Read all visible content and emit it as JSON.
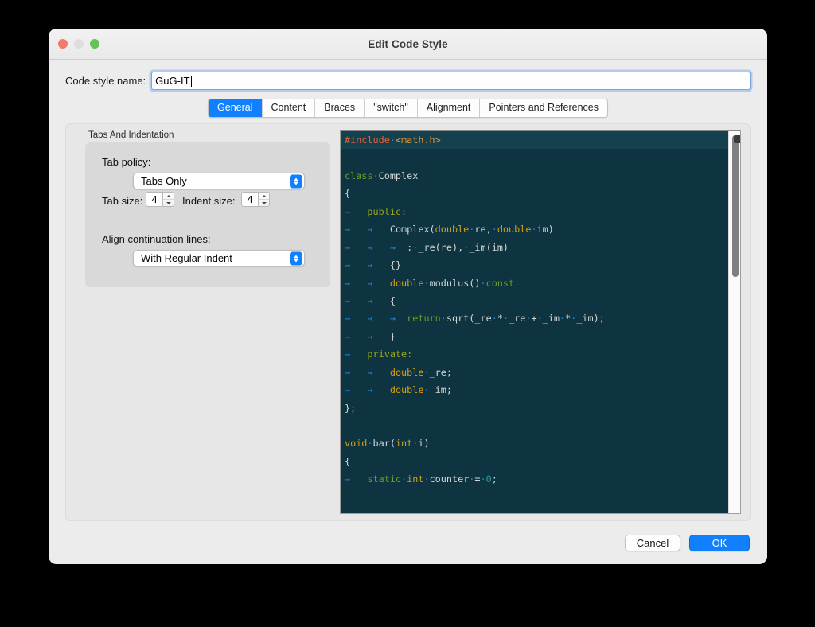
{
  "window": {
    "title": "Edit Code Style",
    "traffic_lights": [
      "close",
      "minimize",
      "zoom"
    ]
  },
  "name_row": {
    "label": "Code style name:",
    "value": "GuG-IT",
    "placeholder": ""
  },
  "tabs": [
    {
      "label": "General",
      "active": true
    },
    {
      "label": "Content",
      "active": false
    },
    {
      "label": "Braces",
      "active": false
    },
    {
      "label": "\"switch\"",
      "active": false
    },
    {
      "label": "Alignment",
      "active": false
    },
    {
      "label": "Pointers and References",
      "active": false
    }
  ],
  "settings": {
    "group_title": "Tabs And Indentation",
    "tab_policy_label": "Tab policy:",
    "tab_policy_value": "Tabs Only",
    "tab_size_label": "Tab size:",
    "tab_size_value": "4",
    "indent_size_label": "Indent size:",
    "indent_size_value": "4",
    "align_label": "Align continuation lines:",
    "align_value": "With Regular Indent"
  },
  "preview": {
    "background": "#0d3440",
    "caret_line_background": "#14414d",
    "colors": {
      "preprocessor": "#e8603c",
      "string": "#df9a41",
      "keyword": "#6d9d28",
      "label": "#9aa818",
      "type": "#d2a017",
      "number": "#2e9e9e",
      "whitespace": "#1f87d6",
      "text": "#d4d8d6"
    },
    "lines": [
      {
        "caret": true,
        "tokens": [
          {
            "t": "#include",
            "c": "pre"
          },
          {
            "t": "·",
            "c": "dot"
          },
          {
            "t": "<math.h>",
            "c": "str"
          }
        ]
      },
      {
        "caret": false,
        "tokens": []
      },
      {
        "caret": false,
        "tokens": [
          {
            "t": "class",
            "c": "kw"
          },
          {
            "t": "·",
            "c": "dot"
          },
          {
            "t": "Complex",
            "c": "txt"
          }
        ]
      },
      {
        "caret": false,
        "tokens": [
          {
            "t": "{",
            "c": "txt"
          }
        ]
      },
      {
        "caret": false,
        "tokens": [
          {
            "t": "→   ",
            "c": "tab"
          },
          {
            "t": "public:",
            "c": "label"
          }
        ]
      },
      {
        "caret": false,
        "tokens": [
          {
            "t": "→   ",
            "c": "tab"
          },
          {
            "t": "→   ",
            "c": "tab"
          },
          {
            "t": "Complex(",
            "c": "txt"
          },
          {
            "t": "double",
            "c": "type"
          },
          {
            "t": "·",
            "c": "dot"
          },
          {
            "t": "re,",
            "c": "txt"
          },
          {
            "t": "·",
            "c": "dot"
          },
          {
            "t": "double",
            "c": "type"
          },
          {
            "t": "·",
            "c": "dot"
          },
          {
            "t": "im)",
            "c": "txt"
          }
        ]
      },
      {
        "caret": false,
        "tokens": [
          {
            "t": "→   ",
            "c": "tab"
          },
          {
            "t": "→   ",
            "c": "tab"
          },
          {
            "t": "→  ",
            "c": "tab"
          },
          {
            "t": ":",
            "c": "txt"
          },
          {
            "t": "·",
            "c": "dot"
          },
          {
            "t": "_re(re),",
            "c": "txt"
          },
          {
            "t": "·",
            "c": "dot"
          },
          {
            "t": "_im(im)",
            "c": "txt"
          }
        ]
      },
      {
        "caret": false,
        "tokens": [
          {
            "t": "→   ",
            "c": "tab"
          },
          {
            "t": "→   ",
            "c": "tab"
          },
          {
            "t": "{}",
            "c": "txt"
          }
        ]
      },
      {
        "caret": false,
        "tokens": [
          {
            "t": "→   ",
            "c": "tab"
          },
          {
            "t": "→   ",
            "c": "tab"
          },
          {
            "t": "double",
            "c": "type"
          },
          {
            "t": "·",
            "c": "dot"
          },
          {
            "t": "modulus()",
            "c": "txt"
          },
          {
            "t": "·",
            "c": "dot"
          },
          {
            "t": "const",
            "c": "kw"
          }
        ]
      },
      {
        "caret": false,
        "tokens": [
          {
            "t": "→   ",
            "c": "tab"
          },
          {
            "t": "→   ",
            "c": "tab"
          },
          {
            "t": "{",
            "c": "txt"
          }
        ]
      },
      {
        "caret": false,
        "tokens": [
          {
            "t": "→   ",
            "c": "tab"
          },
          {
            "t": "→   ",
            "c": "tab"
          },
          {
            "t": "→  ",
            "c": "tab"
          },
          {
            "t": "return",
            "c": "kw"
          },
          {
            "t": "·",
            "c": "dot"
          },
          {
            "t": "sqrt(_re",
            "c": "txt"
          },
          {
            "t": "·",
            "c": "dot"
          },
          {
            "t": "*",
            "c": "txt"
          },
          {
            "t": "·",
            "c": "dot"
          },
          {
            "t": "_re",
            "c": "txt"
          },
          {
            "t": "·",
            "c": "dot"
          },
          {
            "t": "+",
            "c": "txt"
          },
          {
            "t": "·",
            "c": "dot"
          },
          {
            "t": "_im",
            "c": "txt"
          },
          {
            "t": "·",
            "c": "dot"
          },
          {
            "t": "*",
            "c": "txt"
          },
          {
            "t": "·",
            "c": "dot"
          },
          {
            "t": "_im);",
            "c": "txt"
          }
        ]
      },
      {
        "caret": false,
        "tokens": [
          {
            "t": "→   ",
            "c": "tab"
          },
          {
            "t": "→   ",
            "c": "tab"
          },
          {
            "t": "}",
            "c": "txt"
          }
        ]
      },
      {
        "caret": false,
        "tokens": [
          {
            "t": "→   ",
            "c": "tab"
          },
          {
            "t": "private:",
            "c": "label"
          }
        ]
      },
      {
        "caret": false,
        "tokens": [
          {
            "t": "→   ",
            "c": "tab"
          },
          {
            "t": "→   ",
            "c": "tab"
          },
          {
            "t": "double",
            "c": "type"
          },
          {
            "t": "·",
            "c": "dot"
          },
          {
            "t": "_re;",
            "c": "txt"
          }
        ]
      },
      {
        "caret": false,
        "tokens": [
          {
            "t": "→   ",
            "c": "tab"
          },
          {
            "t": "→   ",
            "c": "tab"
          },
          {
            "t": "double",
            "c": "type"
          },
          {
            "t": "·",
            "c": "dot"
          },
          {
            "t": "_im;",
            "c": "txt"
          }
        ]
      },
      {
        "caret": false,
        "tokens": [
          {
            "t": "};",
            "c": "txt"
          }
        ]
      },
      {
        "caret": false,
        "tokens": []
      },
      {
        "caret": false,
        "tokens": [
          {
            "t": "void",
            "c": "type"
          },
          {
            "t": "·",
            "c": "dot"
          },
          {
            "t": "bar(",
            "c": "txt"
          },
          {
            "t": "int",
            "c": "type"
          },
          {
            "t": "·",
            "c": "dot"
          },
          {
            "t": "i)",
            "c": "txt"
          }
        ]
      },
      {
        "caret": false,
        "tokens": [
          {
            "t": "{",
            "c": "txt"
          }
        ]
      },
      {
        "caret": false,
        "tokens": [
          {
            "t": "→   ",
            "c": "tab"
          },
          {
            "t": "static",
            "c": "kw"
          },
          {
            "t": "·",
            "c": "dot"
          },
          {
            "t": "int",
            "c": "type"
          },
          {
            "t": "·",
            "c": "dot"
          },
          {
            "t": "counter",
            "c": "txt"
          },
          {
            "t": "·",
            "c": "dot"
          },
          {
            "t": "=",
            "c": "txt"
          },
          {
            "t": "·",
            "c": "dot"
          },
          {
            "t": "0",
            "c": "num"
          },
          {
            "t": ";",
            "c": "txt"
          }
        ]
      }
    ]
  },
  "footer": {
    "cancel_label": "Cancel",
    "ok_label": "OK",
    "ok_accent": "#1080ff"
  }
}
